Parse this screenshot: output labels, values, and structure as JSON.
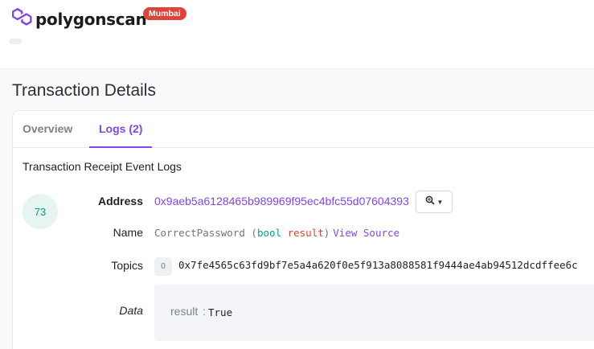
{
  "header": {
    "logo_text": "polygonscan",
    "network_badge": "Mumbai",
    "brand_color": "#8247e5",
    "badge_color": "#de4437",
    "logo_icon": "polygon-logo-icon"
  },
  "page": {
    "title": "Transaction Details"
  },
  "tabs": [
    {
      "label": "Overview",
      "active": false
    },
    {
      "label": "Logs (2)",
      "active": true
    }
  ],
  "logs": {
    "heading": "Transaction Receipt Event Logs",
    "entry": {
      "index": "73",
      "address_label": "Address",
      "address": "0x9aeb5a6128465b989969f95ec4bfc55d07604393",
      "address_button_icon": "zoom-in-icon",
      "name_label": "Name",
      "event_name": "CorrectPassword",
      "open_paren": " (",
      "param_type": "bool",
      "param_name": "result",
      "close_paren": ")",
      "view_source": "View Source",
      "topics_label": "Topics",
      "topic_index": "0",
      "topic_value": "0x7fe4565c63fd9bf7e5a4a620f0e5f913a8088581f9444ae4ab94512dcdffee6c",
      "data_label": "Data",
      "data_key": "result",
      "data_sep": ":",
      "data_value": "True"
    }
  }
}
